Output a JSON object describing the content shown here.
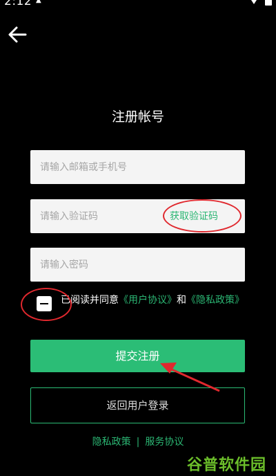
{
  "status_bar": {
    "time": "2:12",
    "icons": [
      "notification-icon",
      "wifi-icon",
      "battery-icon"
    ]
  },
  "header": {
    "back_icon": "arrow-left-icon",
    "title": "注册帐号"
  },
  "form": {
    "email_placeholder": "请输入邮箱或手机号",
    "email_value": "",
    "code_placeholder": "请输入验证码",
    "code_value": "",
    "get_code_label": "获取验证码",
    "password_placeholder": "请输入密码",
    "password_value": ""
  },
  "agreement": {
    "checkbox_state": "indeterminate",
    "prefix": "已阅读并同意",
    "user_agreement": "《用户协议》",
    "and": "和",
    "privacy_policy": "《隐私政策》"
  },
  "buttons": {
    "submit": "提交注册",
    "back_to_login": "返回用户登录"
  },
  "footer": {
    "privacy": "隐私政策",
    "separator": "|",
    "service": "服务协议"
  },
  "watermark": {
    "text": "谷普软件园"
  },
  "colors": {
    "background": "#000000",
    "accent": "#2bbd76",
    "field_bg": "#f4f4f4",
    "annotation": "#e0282e"
  }
}
